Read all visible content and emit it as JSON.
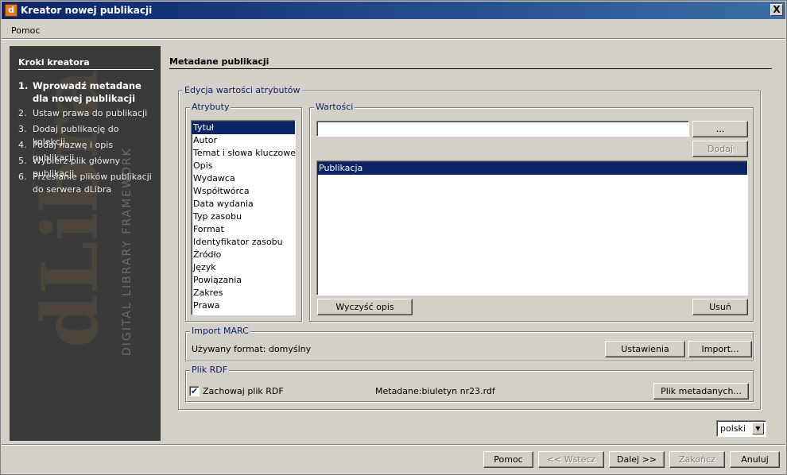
{
  "window": {
    "title": "Kreator nowej publikacji",
    "app_icon": "dlibra-app-icon",
    "close_label": "X"
  },
  "menubar": {
    "help": "Pomoc"
  },
  "sidebar": {
    "title": "Kroki kreatora",
    "watermark_brand": "dLibra",
    "watermark_sub": "DIGITAL LIBRARY FRAMEWORK",
    "steps": [
      {
        "num": "1.",
        "label": "Wprowadź metadane dla nowej publikacji",
        "active": true
      },
      {
        "num": "2.",
        "label": "Ustaw prawa do publikacji"
      },
      {
        "num": "3.",
        "label": "Dodaj publikację do kolekcji"
      },
      {
        "num": "4.",
        "label": "Podaj nazwę i opis publikacji"
      },
      {
        "num": "5.",
        "label": "Wybierz plik główny publikacji"
      },
      {
        "num": "6.",
        "label": "Przesłanie plików publikacji do serwera dLibra"
      }
    ]
  },
  "main": {
    "title": "Metadane publikacji",
    "edit_group": "Edycja wartości atrybutów",
    "attributes": {
      "legend": "Atrybuty",
      "items": [
        "Tytuł",
        "Autor",
        "Temat i słowa kluczowe",
        "Opis",
        "Wydawca",
        "Współtwórca",
        "Data wydania",
        "Typ zasobu",
        "Format",
        "Identyfikator zasobu",
        "Źródło",
        "Język",
        "Powiązania",
        "Zakres",
        "Prawa"
      ],
      "selected": "Tytuł"
    },
    "values": {
      "legend": "Wartości",
      "input_value": "",
      "browse_button": "...",
      "add_button": "Dodaj",
      "items": [
        "Publikacja"
      ],
      "clear_button": "Wyczyść opis",
      "remove_button": "Usuń"
    },
    "marc": {
      "legend": "Import MARC",
      "format_text": "Używany format: domyślny",
      "settings_button": "Ustawienia",
      "import_button": "Import..."
    },
    "rdf": {
      "legend": "Plik RDF",
      "keep_checked": true,
      "keep_label": "Zachowaj plik RDF",
      "metadata_text": "Metadane:biuletyn nr23.rdf",
      "metadata_button": "Plik metadanych..."
    },
    "language": {
      "value": "polski"
    }
  },
  "footer": {
    "help": "Pomoc",
    "back": "<< Wstecz",
    "next": "Dalej >>",
    "finish": "Zakończ",
    "cancel": "Anuluj"
  }
}
